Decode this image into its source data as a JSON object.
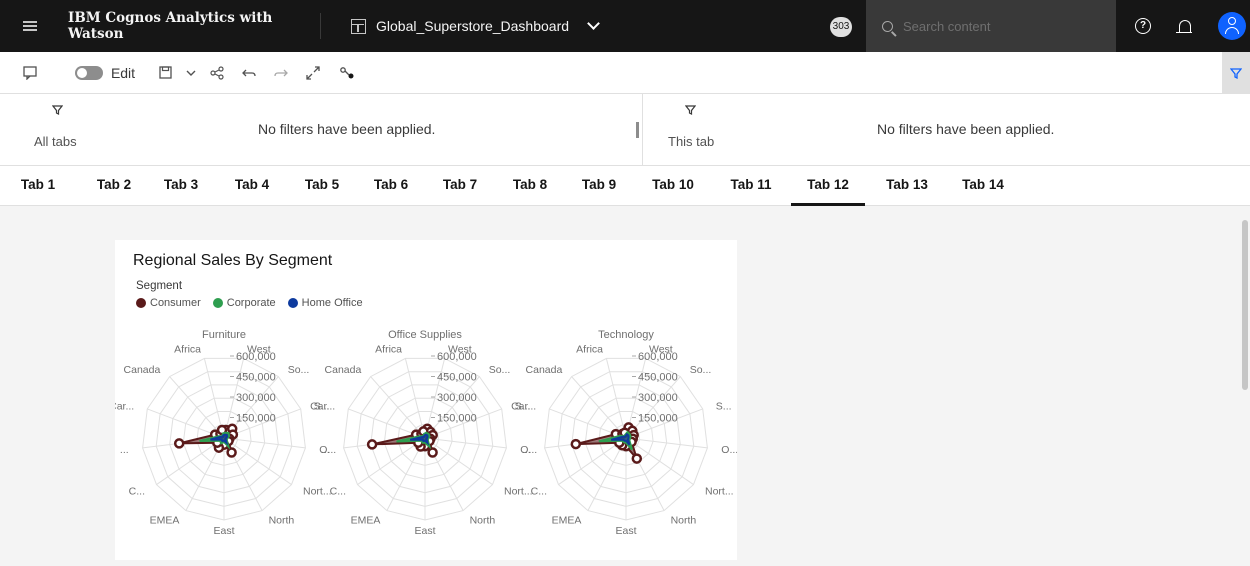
{
  "app": {
    "product_name": "IBM Cognos Analytics with Watson",
    "dashboard_name": "Global_Superstore_Dashboard",
    "notification_badge": "303",
    "search_placeholder": "Search content"
  },
  "toolbar": {
    "edit_label": "Edit"
  },
  "filters": {
    "left": {
      "label": "All tabs",
      "message": "No filters have been applied."
    },
    "right": {
      "label": "This tab",
      "message": "No filters have been applied."
    }
  },
  "tabs": [
    {
      "label": "Tab 1"
    },
    {
      "label": "Tab 2"
    },
    {
      "label": "Tab 3"
    },
    {
      "label": "Tab 4"
    },
    {
      "label": "Tab 5"
    },
    {
      "label": "Tab 6"
    },
    {
      "label": "Tab 7"
    },
    {
      "label": "Tab 8"
    },
    {
      "label": "Tab 9"
    },
    {
      "label": "Tab 10"
    },
    {
      "label": "Tab 11"
    },
    {
      "label": "Tab 12"
    },
    {
      "label": "Tab 13"
    },
    {
      "label": "Tab 14"
    }
  ],
  "active_tab": "Tab 12",
  "widget": {
    "title": "Regional Sales By Segment",
    "legend_title": "Segment"
  },
  "chart_data": {
    "type": "radar",
    "title": "Regional Sales By Segment",
    "legend_title": "Segment",
    "legend_position": "top-left",
    "axes": [
      "West",
      "So...",
      "S...",
      "O...",
      "Nort...",
      "North",
      "East",
      "EMEA",
      "C...",
      "...",
      "Car...",
      "Canada",
      "Africa"
    ],
    "r_ticks": [
      "150,000",
      "300,000",
      "450,000",
      "600,000"
    ],
    "r_max": 600000,
    "series_colors": {
      "Consumer": "#5a1a1a",
      "Corporate": "#2e9e4f",
      "Home Office": "#0d3a9e"
    },
    "panels": [
      {
        "name": "Furniture",
        "series": [
          {
            "name": "Consumer",
            "values": [
              60000,
              90000,
              70000,
              40000,
              40000,
              120000,
              50000,
              80000,
              60000,
              330000,
              70000,
              40000,
              60000
            ]
          },
          {
            "name": "Corporate",
            "values": [
              40000,
              50000,
              40000,
              25000,
              25000,
              70000,
              30000,
              45000,
              35000,
              180000,
              40000,
              20000,
              35000
            ]
          },
          {
            "name": "Home Office",
            "values": [
              25000,
              30000,
              25000,
              15000,
              15000,
              40000,
              20000,
              25000,
              20000,
              100000,
              25000,
              12000,
              20000
            ]
          }
        ]
      },
      {
        "name": "Office Supplies",
        "series": [
          {
            "name": "Consumer",
            "values": [
              70000,
              60000,
              60000,
              40000,
              40000,
              120000,
              60000,
              70000,
              60000,
              390000,
              70000,
              40000,
              50000
            ]
          },
          {
            "name": "Corporate",
            "values": [
              40000,
              40000,
              35000,
              25000,
              25000,
              70000,
              35000,
              40000,
              35000,
              210000,
              40000,
              20000,
              30000
            ]
          },
          {
            "name": "Home Office",
            "values": [
              25000,
              25000,
              20000,
              15000,
              15000,
              40000,
              20000,
              25000,
              20000,
              110000,
              20000,
              12000,
              18000
            ]
          }
        ]
      },
      {
        "name": "Technology",
        "series": [
          {
            "name": "Consumer",
            "values": [
              80000,
              70000,
              60000,
              50000,
              50000,
              170000,
              60000,
              60000,
              60000,
              370000,
              80000,
              40000,
              40000
            ]
          },
          {
            "name": "Corporate",
            "values": [
              45000,
              40000,
              35000,
              30000,
              30000,
              95000,
              35000,
              35000,
              35000,
              200000,
              45000,
              20000,
              25000
            ]
          },
          {
            "name": "Home Office",
            "values": [
              28000,
              25000,
              20000,
              18000,
              18000,
              55000,
              20000,
              22000,
              22000,
              110000,
              25000,
              12000,
              15000
            ]
          }
        ]
      }
    ]
  }
}
